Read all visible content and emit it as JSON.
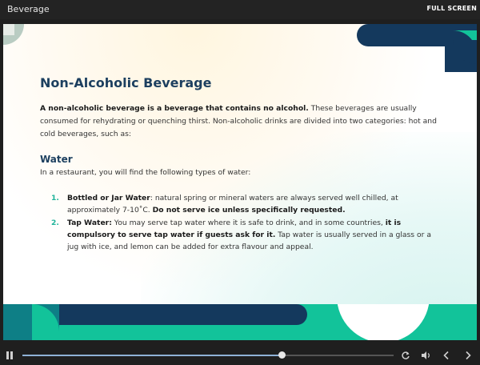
{
  "window": {
    "title": "Beverage",
    "fullscreen_label": "FULL SCREEN"
  },
  "slide": {
    "heading": "Non-Alcoholic Beverage",
    "intro": {
      "bold_lead": "A non-alcoholic beverage is a beverage that contains no alcohol.",
      "rest": " These beverages are usually consumed for rehydrating or quenching thirst. Non-alcoholic drinks are divided into two categories: hot and cold beverages, such as:"
    },
    "section_title": "Water",
    "section_sub": "In a restaurant, you will find the following types of water:",
    "items": [
      {
        "num": "1.",
        "bold": "Bottled or Jar Water",
        "text": ": natural spring or mineral waters are always served well chilled, at approximately 7-10˚C. ",
        "bold2": "Do not serve ice unless specifically requested.",
        "text2": ""
      },
      {
        "num": "2.",
        "bold": "Tap Water:",
        "text": " You may serve tap water where it is safe to drink, and in some countries, ",
        "bold2": "it is compulsory to serve tap water if guests ask for it.",
        "text2": " Tap water is usually served in a glass or a jug with ice, and lemon can be added for extra flavour and appeal."
      }
    ]
  },
  "player": {
    "progress": 0.7,
    "icons": [
      "pause-icon",
      "replay-icon",
      "volume-icon",
      "prev-icon",
      "next-icon"
    ]
  },
  "colors": {
    "navy": "#1c3f5f",
    "teal": "#0cbf9a",
    "dark_teal": "#0e7f86"
  }
}
